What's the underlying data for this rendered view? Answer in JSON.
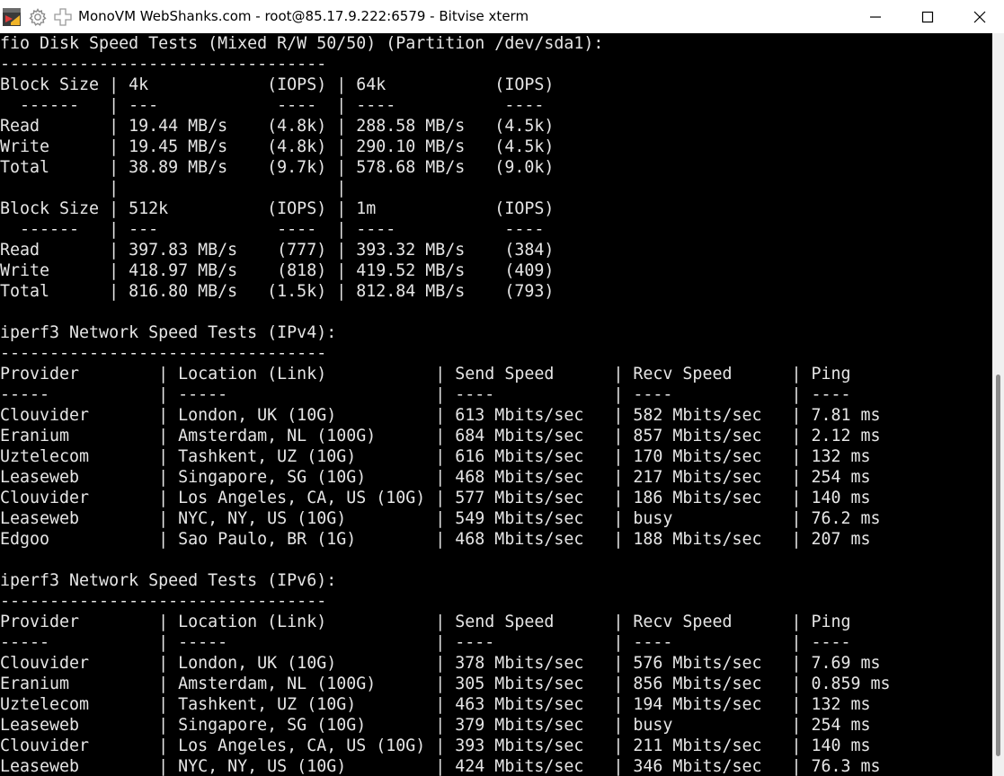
{
  "window": {
    "title": "MonoVM WebShanks.com - root@85.17.9.222:6579 - Bitvise xterm",
    "icons": [
      "app-icon",
      "gear-icon",
      "plus-icon"
    ],
    "controls": [
      "minimize-icon",
      "maximize-icon",
      "close-icon"
    ]
  },
  "colors": {
    "terminal_bg": "#000000",
    "terminal_fg": "#e6e6e6",
    "titlebar_bg": "#ffffff"
  },
  "terminal": {
    "lines": [
      "fio Disk Speed Tests (Mixed R/W 50/50) (Partition /dev/sda1):",
      "---------------------------------",
      "Block Size | 4k            (IOPS) | 64k           (IOPS)",
      "  ------   | ---            ----  | ----           ---- ",
      "Read       | 19.44 MB/s    (4.8k) | 288.58 MB/s   (4.5k)",
      "Write      | 19.45 MB/s    (4.8k) | 290.10 MB/s   (4.5k)",
      "Total      | 38.89 MB/s    (9.7k) | 578.68 MB/s   (9.0k)",
      "           |                      |                     ",
      "Block Size | 512k          (IOPS) | 1m            (IOPS)",
      "  ------   | ---            ----  | ----           ---- ",
      "Read       | 397.83 MB/s    (777) | 393.32 MB/s    (384)",
      "Write      | 418.97 MB/s    (818) | 419.52 MB/s    (409)",
      "Total      | 816.80 MB/s   (1.5k) | 812.84 MB/s    (793)",
      "",
      "iperf3 Network Speed Tests (IPv4):",
      "---------------------------------",
      "Provider        | Location (Link)           | Send Speed      | Recv Speed      | Ping",
      "-----           | -----                     | ----            | ----            | ----",
      "Clouvider       | London, UK (10G)          | 613 Mbits/sec   | 582 Mbits/sec   | 7.81 ms",
      "Eranium         | Amsterdam, NL (100G)      | 684 Mbits/sec   | 857 Mbits/sec   | 2.12 ms",
      "Uztelecom       | Tashkent, UZ (10G)        | 616 Mbits/sec   | 170 Mbits/sec   | 132 ms",
      "Leaseweb        | Singapore, SG (10G)       | 468 Mbits/sec   | 217 Mbits/sec   | 254 ms",
      "Clouvider       | Los Angeles, CA, US (10G) | 577 Mbits/sec   | 186 Mbits/sec   | 140 ms",
      "Leaseweb        | NYC, NY, US (10G)         | 549 Mbits/sec   | busy            | 76.2 ms",
      "Edgoo           | Sao Paulo, BR (1G)        | 468 Mbits/sec   | 188 Mbits/sec   | 207 ms",
      "",
      "iperf3 Network Speed Tests (IPv6):",
      "---------------------------------",
      "Provider        | Location (Link)           | Send Speed      | Recv Speed      | Ping",
      "-----           | -----                     | ----            | ----            | ----",
      "Clouvider       | London, UK (10G)          | 378 Mbits/sec   | 576 Mbits/sec   | 7.69 ms",
      "Eranium         | Amsterdam, NL (100G)      | 305 Mbits/sec   | 856 Mbits/sec   | 0.859 ms",
      "Uztelecom       | Tashkent, UZ (10G)        | 463 Mbits/sec   | 194 Mbits/sec   | 132 ms",
      "Leaseweb        | Singapore, SG (10G)       | 379 Mbits/sec   | busy            | 254 ms",
      "Clouvider       | Los Angeles, CA, US (10G) | 393 Mbits/sec   | 211 Mbits/sec   | 140 ms",
      "Leaseweb        | NYC, NY, US (10G)         | 424 Mbits/sec   | 346 Mbits/sec   | 76.3 ms"
    ]
  }
}
